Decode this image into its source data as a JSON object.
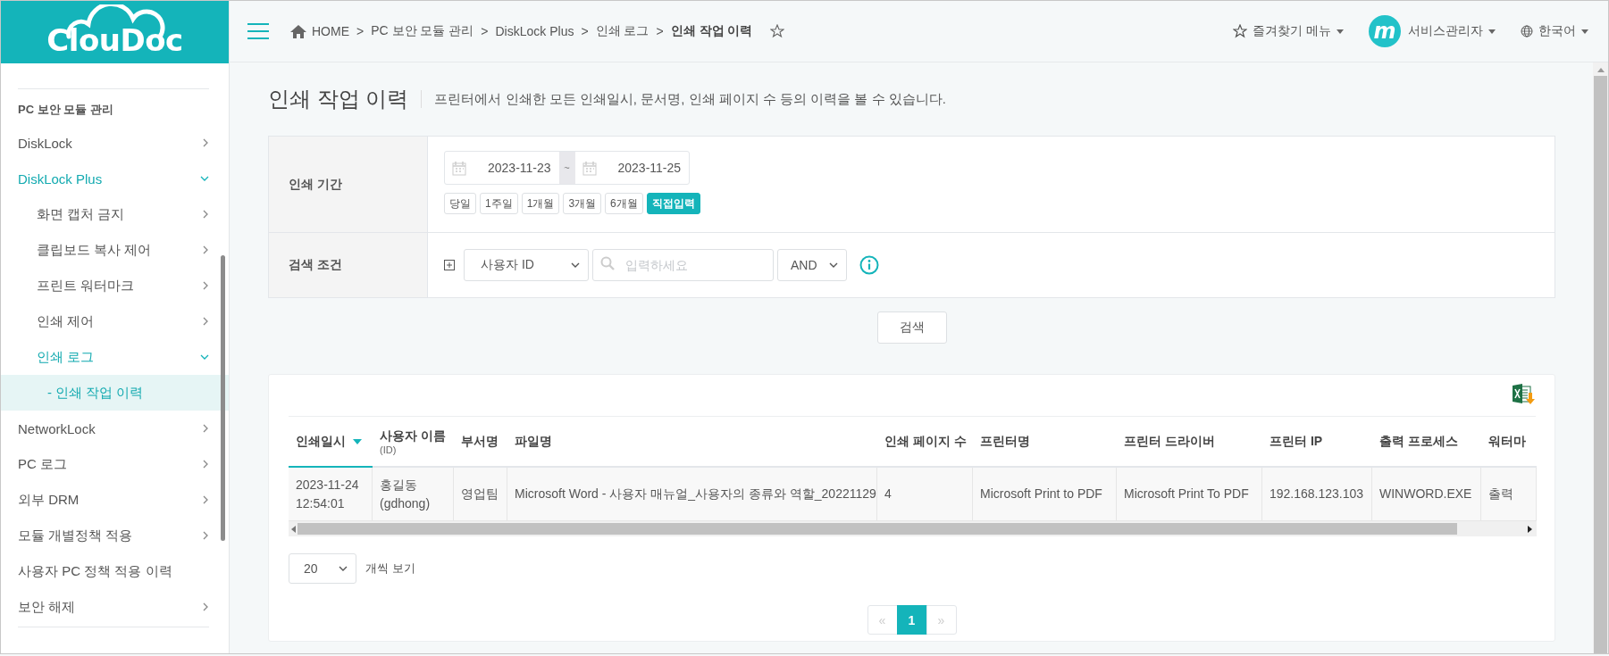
{
  "sidebar": {
    "logo_text": "ClouDoc",
    "section_title": "PC 보안 모듈 관리",
    "items": [
      {
        "label": "DiskLock",
        "expandable": true,
        "expanded": false,
        "selected": false
      },
      {
        "label": "DiskLock Plus",
        "expandable": true,
        "expanded": true,
        "selected": false,
        "children": [
          {
            "label": "화면 캡처 금지",
            "expandable": true,
            "expanded": false,
            "selected": false
          },
          {
            "label": "클립보드 복사 제어",
            "expandable": true,
            "expanded": false,
            "selected": false
          },
          {
            "label": "프린트 워터마크",
            "expandable": true,
            "expanded": false,
            "selected": false
          },
          {
            "label": "인쇄 제어",
            "expandable": true,
            "expanded": false,
            "selected": false
          },
          {
            "label": "인쇄 로그",
            "expandable": true,
            "expanded": true,
            "selected": false,
            "children": [
              {
                "label": "- 인쇄 작업 이력",
                "expandable": false,
                "expanded": false,
                "selected": true
              }
            ]
          }
        ]
      },
      {
        "label": "NetworkLock",
        "expandable": true,
        "expanded": false,
        "selected": false
      },
      {
        "label": "PC 로그",
        "expandable": true,
        "expanded": false,
        "selected": false
      },
      {
        "label": "외부 DRM",
        "expandable": true,
        "expanded": false,
        "selected": false
      },
      {
        "label": "모듈 개별정책 적용",
        "expandable": true,
        "expanded": false,
        "selected": false
      },
      {
        "label": "사용자 PC 정책 적용 이력",
        "expandable": false,
        "expanded": false,
        "selected": false
      },
      {
        "label": "보안 해제",
        "expandable": true,
        "expanded": false,
        "selected": false
      }
    ]
  },
  "header": {
    "breadcrumb": [
      {
        "label": "HOME",
        "separator": ">",
        "current": false
      },
      {
        "label": "PC 보안 모듈 관리",
        "separator": ">",
        "current": false
      },
      {
        "label": "DiskLock Plus",
        "separator": ">",
        "current": false
      },
      {
        "label": "인쇄 로그",
        "separator": ">",
        "current": false
      },
      {
        "label": "인쇄 작업 이력",
        "current": true
      }
    ],
    "favorites_menu": "즐겨찾기 메뉴",
    "avatar_text": "m",
    "user_name": "서비스관리자",
    "language": "한국어"
  },
  "page": {
    "title": "인쇄 작업 이력",
    "description": "프린터에서 인쇄한 모든 인쇄일시, 문서명, 인쇄 페이지 수 등의 이력을 볼 수 있습니다."
  },
  "search": {
    "period_label": "인쇄 기간",
    "start_date": "2023-11-23",
    "range_separator": "~",
    "end_date": "2023-11-25",
    "period_buttons": [
      {
        "label": "당일",
        "selected": false
      },
      {
        "label": "1주일",
        "selected": false
      },
      {
        "label": "1개월",
        "selected": false
      },
      {
        "label": "3개월",
        "selected": false
      },
      {
        "label": "6개월",
        "selected": false
      },
      {
        "label": "직접입력",
        "selected": true
      }
    ],
    "condition_label": "검색 조건",
    "field_select": "사용자 ID",
    "keyword_placeholder": "입력하세요",
    "operator_select": "AND",
    "search_button": "검색"
  },
  "results": {
    "columns": [
      {
        "label": "인쇄일시",
        "sorted": true
      },
      {
        "label": "사용자 이름",
        "sublabel": "(ID)",
        "sorted": false
      },
      {
        "label": "부서명",
        "sorted": false
      },
      {
        "label": "파일명",
        "sorted": false
      },
      {
        "label": "인쇄 페이지 수",
        "sorted": false
      },
      {
        "label": "프린터명",
        "sorted": false
      },
      {
        "label": "프린터 드라이버",
        "sorted": false
      },
      {
        "label": "프린터 IP",
        "sorted": false
      },
      {
        "label": "출력 프로세스",
        "sorted": false
      },
      {
        "label": "워터마",
        "sorted": false
      }
    ],
    "rows": [
      [
        "2023-11-24 12:54:01",
        "홍길동 (gdhong)",
        "영업팀",
        "Microsoft Word - 사용자 매뉴얼_사용자의 종류와 역할_20221129",
        "4",
        "Microsoft Print to PDF",
        "Microsoft Print To PDF",
        "192.168.123.103",
        "WINWORD.EXE",
        "출력"
      ]
    ],
    "page_size": "20",
    "page_size_label": "개씩 보기",
    "pagination": {
      "first": {
        "label": "«",
        "disabled": true
      },
      "pages": [
        {
          "label": "1",
          "selected": true
        }
      ],
      "last": {
        "label": "»",
        "disabled": true
      }
    }
  }
}
